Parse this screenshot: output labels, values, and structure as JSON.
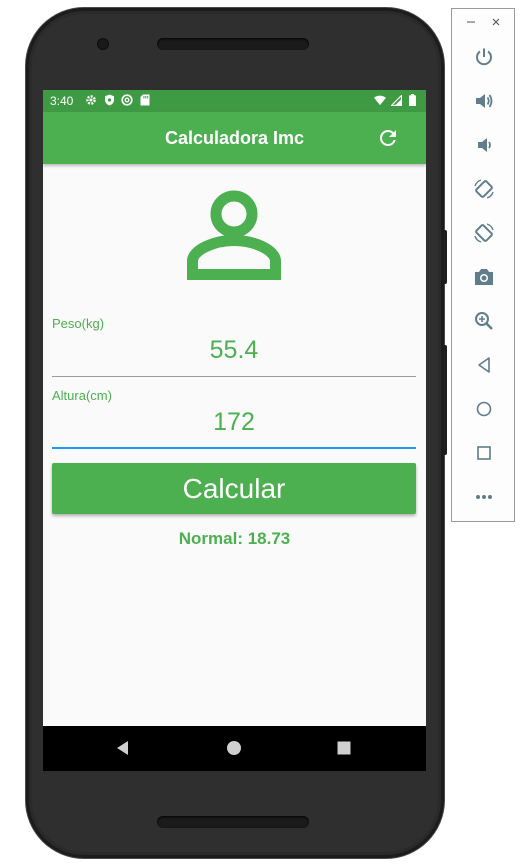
{
  "status_bar": {
    "time": "3:40"
  },
  "app_bar": {
    "title": "Calculadora Imc"
  },
  "form": {
    "weight": {
      "label": "Peso(kg)",
      "value": "55.4"
    },
    "height": {
      "label": "Altura(cm)",
      "value": "172"
    },
    "submit_label": "Calcular"
  },
  "result_text": "Normal: 18.73",
  "colors": {
    "primary": "#4caf50",
    "status_bar": "#3f9a44",
    "focus_underline": "#2196f3",
    "background": "#fafafa"
  },
  "icons": {
    "app_bar_action": "refresh-icon",
    "avatar": "person-outline-icon",
    "nav": [
      "back-icon",
      "home-icon",
      "recents-icon"
    ],
    "emulator_toolbar": [
      "minimize-icon",
      "close-icon",
      "power-icon",
      "volume-up-icon",
      "volume-down-icon",
      "rotate-left-icon",
      "rotate-right-icon",
      "screenshot-icon",
      "zoom-icon",
      "back-icon",
      "home-icon",
      "overview-icon",
      "more-icon"
    ]
  }
}
